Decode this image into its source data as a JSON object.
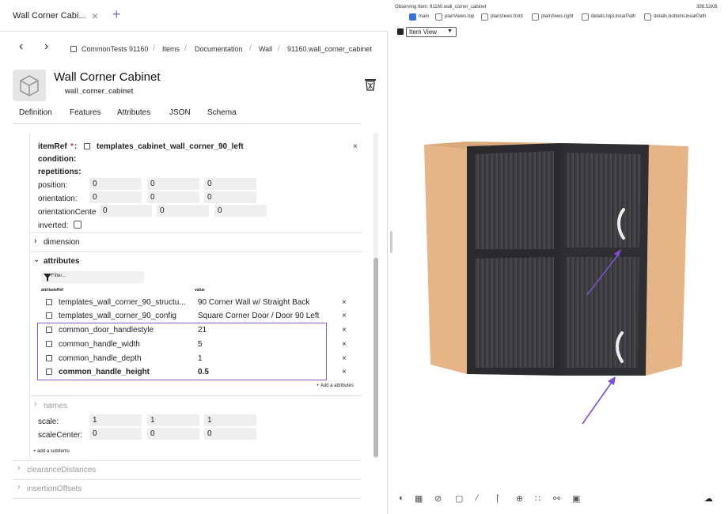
{
  "tab": {
    "title": "Wall Corner Cabi...",
    "close": "×",
    "add": "+"
  },
  "nav": {
    "back": "‹",
    "forward": "›"
  },
  "breadcrumb": [
    "CommonTests 91160",
    "Items",
    "Documentation",
    "Wall",
    "91160.wall_corner_cabinet"
  ],
  "breadcrumb_sep": "/",
  "header": {
    "title": "Wall Corner Cabinet",
    "subtitle": "wall_corner_cabinet"
  },
  "tabs": [
    "Definition",
    "Features",
    "Attributes",
    "JSON",
    "Schema"
  ],
  "item": {
    "itemref_label": "itemRef",
    "itemref_required": "*",
    "itemref_colon": ":",
    "itemref_value": "templates_cabinet_wall_corner_90_left",
    "close": "×",
    "condition_label": "condition:",
    "repetitions_label": "repetitions:",
    "position_label": "position:",
    "position": [
      "0",
      "0",
      "0"
    ],
    "orientation_label": "orientation:",
    "orientation": [
      "0",
      "0",
      "0"
    ],
    "orientationcenter_label": "orientationCente",
    "orientationcenter": [
      "0",
      "0",
      "0"
    ],
    "inverted_label": "inverted:",
    "dimension_label": "dimension",
    "attributes_label": "attributes",
    "filter_placeholder": "Filter...",
    "col_attr": "attributeRef",
    "col_value": "value",
    "rows": [
      {
        "ref": "templates_wall_corner_90_structu...",
        "value": "90 Corner Wall w/ Straight Back",
        "bold": false
      },
      {
        "ref": "templates_wall_corner_90_config",
        "value": "Square Corner Door / Door 90 Left",
        "bold": false
      },
      {
        "ref": "common_door_handlestyle",
        "value": "21",
        "bold": false
      },
      {
        "ref": "common_handle_width",
        "value": "5",
        "bold": false
      },
      {
        "ref": "common_handle_depth",
        "value": "1",
        "bold": false
      },
      {
        "ref": "common_handle_height",
        "value": "0.5",
        "bold": true
      }
    ],
    "add_attribute": "+ Add a attributes",
    "names_label": "names",
    "scale_label": "scale:",
    "scale": [
      "1",
      "1",
      "1"
    ],
    "scalecenter_label": "scaleCenter:",
    "scalecenter": [
      "0",
      "0",
      "0"
    ],
    "add_subitem": "+ add a subitems",
    "clearance_label": "clearanceDistances",
    "insertion_label": "insertionOffsets"
  },
  "viewer": {
    "observing": "Observing Item: 91160.wall_corner_cabinet",
    "size": "398.52KB",
    "views": [
      {
        "label": "main",
        "checked": true
      },
      {
        "label": "planViews.top",
        "checked": false
      },
      {
        "label": "planViews.front",
        "checked": false
      },
      {
        "label": "planViews.right",
        "checked": false
      },
      {
        "label": "details.topLinearPath",
        "checked": false
      },
      {
        "label": "details.bottomLinearPath",
        "checked": false
      }
    ],
    "view_select": "Item View"
  },
  "colors": {
    "accent": "#7a4fd6",
    "highlight_border": "#8a5cd8",
    "cabinet_side": "#e5b487",
    "door": "#3d3d40"
  }
}
